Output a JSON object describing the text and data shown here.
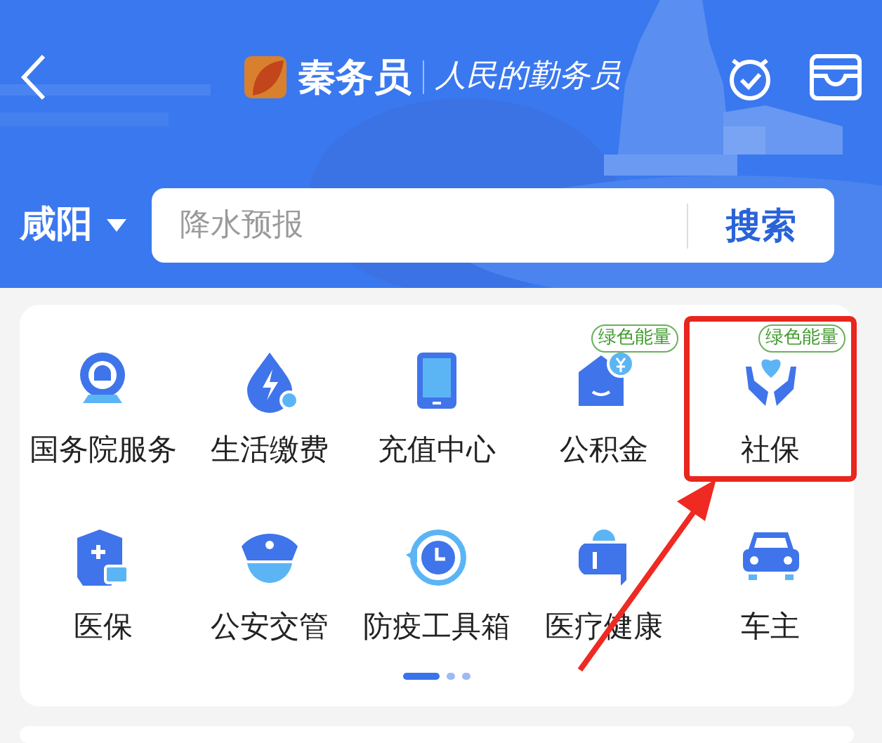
{
  "header": {
    "brand": "秦务员",
    "slogan": "人民的勤务员"
  },
  "search": {
    "city": "咸阳",
    "placeholder": "降水预报",
    "button": "搜索"
  },
  "services": [
    {
      "label": "国务院服务",
      "highlighted": false
    },
    {
      "label": "生活缴费",
      "highlighted": false
    },
    {
      "label": "充值中心",
      "highlighted": false
    },
    {
      "label": "公积金",
      "badge": "绿色能量",
      "highlighted": false
    },
    {
      "label": "社保",
      "badge": "绿色能量",
      "highlighted": true
    },
    {
      "label": "医保",
      "highlighted": false
    },
    {
      "label": "公安交管",
      "highlighted": false
    },
    {
      "label": "防疫工具箱",
      "highlighted": false
    },
    {
      "label": "医疗健康",
      "highlighted": false
    },
    {
      "label": "车主",
      "highlighted": false
    }
  ],
  "pager": [
    {
      "selected": true
    },
    {
      "selected": false
    },
    {
      "selected": false
    }
  ]
}
